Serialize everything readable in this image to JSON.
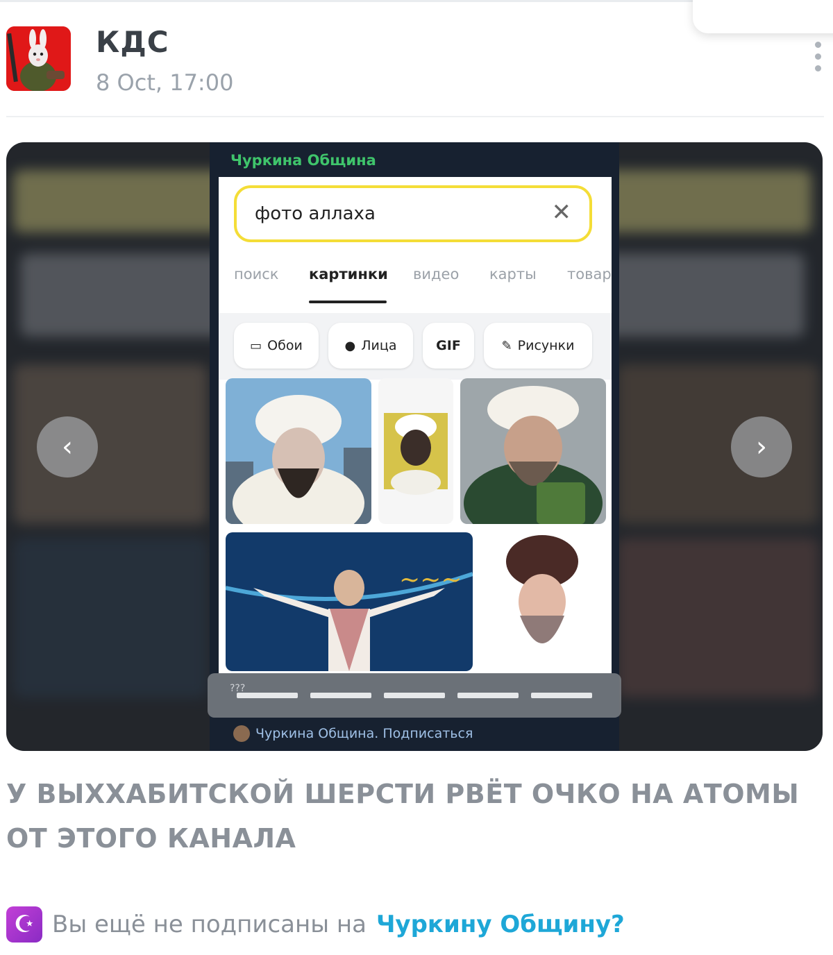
{
  "post": {
    "channel_name": "КДС",
    "date": "8 Oct, 17:00",
    "menu_icon": "kebab-menu-icon"
  },
  "media": {
    "embedded_screenshot": {
      "channel_label": "Чуркина Община",
      "search_query": "фото аллаха",
      "tabs": [
        "поиск",
        "картинки",
        "видео",
        "карты",
        "товар"
      ],
      "active_tab": "картинки",
      "chips": [
        {
          "icon": "wallpaper-icon",
          "label": "Обои"
        },
        {
          "icon": "person-icon",
          "label": "Лица"
        },
        {
          "icon": "",
          "label": "GIF"
        },
        {
          "icon": "drawing-icon",
          "label": "Рисунки"
        }
      ],
      "progress_text": "???",
      "progress_segments": 5,
      "footer_text": "Чуркина Община. Подписаться"
    },
    "nav_prev_icon": "chevron-left-icon",
    "nav_next_icon": "chevron-right-icon"
  },
  "caption": {
    "text": "У ВЫХХАБИТСКОЙ ШЕРСТИ РВЁТ ОЧКО НА АТОМЫ ОТ ЭТОГО КАНАЛА"
  },
  "promo": {
    "icon": "crescent-star-icon",
    "prefix": "Вы ещё не подписаны на",
    "link_text": "Чуркину Общину?"
  },
  "colors": {
    "channel_green": "#3fc46b",
    "search_border": "#f4dd37",
    "link_blue": "#1ea7d7",
    "avatar_red": "#e01818",
    "promo_purple": "#b03ad2"
  }
}
